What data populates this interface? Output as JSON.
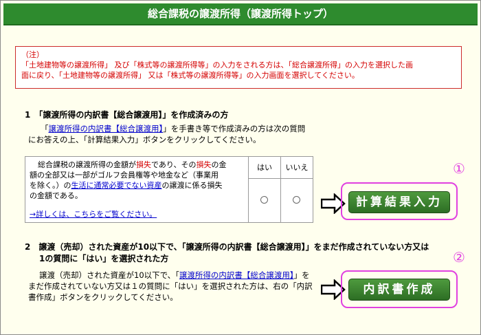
{
  "header": {
    "title": "総合課税の譲渡所得（譲渡所得トップ）"
  },
  "notice": {
    "heading": "（注）",
    "line1": "「土地建物等の譲渡所得」 及び「株式等の譲渡所得等」の入力をされる方は、「総合譲渡所得」の入力を選択した画",
    "line2": "面に戻り、「土地建物等の譲渡所得」 又は「株式等の譲渡所得等」の入力画面を選択してください。"
  },
  "section1": {
    "title": "1　「譲渡所得の内訳書【総合譲渡用】」を作成済みの方",
    "desc_pre": "「",
    "desc_link": "譲渡所得の内訳書【総合譲渡用】",
    "desc_post": "」を手書き等で作成済みの方は次の質問",
    "desc_line2": "にお答えの上、「計算結果入力」ボタンをクリックしてください。",
    "question": {
      "t1": "総合課税の譲渡所得の金額が",
      "r1": "損失",
      "t2": "であり、その",
      "r2": "損失",
      "t3": "の金",
      "line2": "額の全部又は一部がゴルフ会員権等や地金など（事業用",
      "line3_pre": "を除く。）の",
      "line3_link": "生活に通常必要でない資産",
      "line3_post": "の譲渡に係る損失",
      "line4": "の金額である。",
      "more_link": "→詳しくは、こちらをご覧ください。"
    },
    "col_yes": "はい",
    "col_no": "いいえ",
    "button_label": "計算結果入力",
    "marker": "①"
  },
  "section2": {
    "title_line1": "2　譲渡（売却）された資産が10以下で、「譲渡所得の内訳書【総合譲渡用】」をまだ作成されていない方又は",
    "title_line2": "1の質問に「はい」を選択された方",
    "desc_pre": "譲渡（売却）された資産が10以下で、「",
    "desc_link": "譲渡所得の内訳書【総合譲渡用】",
    "desc_post": "」を",
    "desc_line2": "まだ作成されていない方又は１の質問に「はい」を選択された方は、右の「内訳",
    "desc_line3": "書作成」ボタンをクリックしてください。",
    "button_label": "内訳書作成",
    "marker": "②"
  },
  "colors": {
    "header_green": "#2e8b2e",
    "button_green": "#3d8a31",
    "highlight_magenta": "#e040e0",
    "notice_red": "#d40000",
    "link_blue": "#0000cc"
  }
}
